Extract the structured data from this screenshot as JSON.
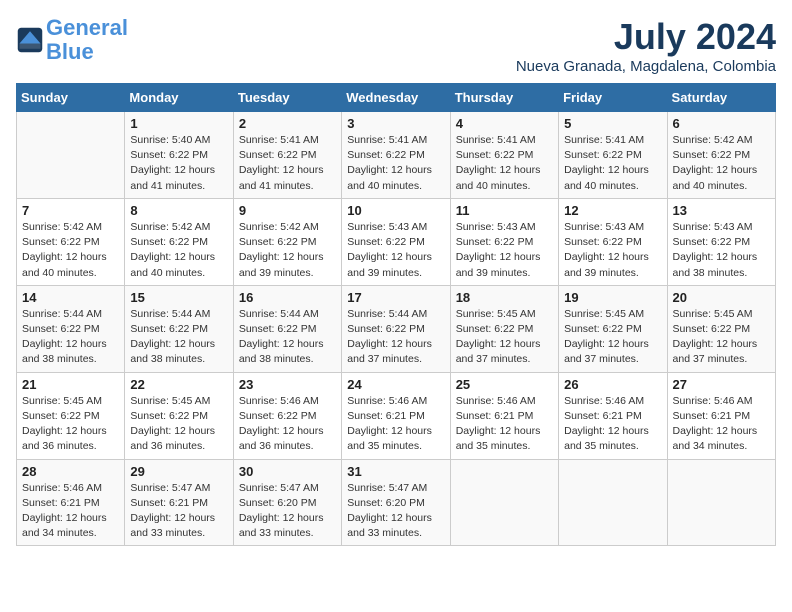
{
  "header": {
    "logo_line1": "General",
    "logo_line2": "Blue",
    "month": "July 2024",
    "location": "Nueva Granada, Magdalena, Colombia"
  },
  "weekdays": [
    "Sunday",
    "Monday",
    "Tuesday",
    "Wednesday",
    "Thursday",
    "Friday",
    "Saturday"
  ],
  "weeks": [
    [
      {
        "day": "",
        "info": ""
      },
      {
        "day": "1",
        "info": "Sunrise: 5:40 AM\nSunset: 6:22 PM\nDaylight: 12 hours\nand 41 minutes."
      },
      {
        "day": "2",
        "info": "Sunrise: 5:41 AM\nSunset: 6:22 PM\nDaylight: 12 hours\nand 41 minutes."
      },
      {
        "day": "3",
        "info": "Sunrise: 5:41 AM\nSunset: 6:22 PM\nDaylight: 12 hours\nand 40 minutes."
      },
      {
        "day": "4",
        "info": "Sunrise: 5:41 AM\nSunset: 6:22 PM\nDaylight: 12 hours\nand 40 minutes."
      },
      {
        "day": "5",
        "info": "Sunrise: 5:41 AM\nSunset: 6:22 PM\nDaylight: 12 hours\nand 40 minutes."
      },
      {
        "day": "6",
        "info": "Sunrise: 5:42 AM\nSunset: 6:22 PM\nDaylight: 12 hours\nand 40 minutes."
      }
    ],
    [
      {
        "day": "7",
        "info": "Sunrise: 5:42 AM\nSunset: 6:22 PM\nDaylight: 12 hours\nand 40 minutes."
      },
      {
        "day": "8",
        "info": "Sunrise: 5:42 AM\nSunset: 6:22 PM\nDaylight: 12 hours\nand 40 minutes."
      },
      {
        "day": "9",
        "info": "Sunrise: 5:42 AM\nSunset: 6:22 PM\nDaylight: 12 hours\nand 39 minutes."
      },
      {
        "day": "10",
        "info": "Sunrise: 5:43 AM\nSunset: 6:22 PM\nDaylight: 12 hours\nand 39 minutes."
      },
      {
        "day": "11",
        "info": "Sunrise: 5:43 AM\nSunset: 6:22 PM\nDaylight: 12 hours\nand 39 minutes."
      },
      {
        "day": "12",
        "info": "Sunrise: 5:43 AM\nSunset: 6:22 PM\nDaylight: 12 hours\nand 39 minutes."
      },
      {
        "day": "13",
        "info": "Sunrise: 5:43 AM\nSunset: 6:22 PM\nDaylight: 12 hours\nand 38 minutes."
      }
    ],
    [
      {
        "day": "14",
        "info": "Sunrise: 5:44 AM\nSunset: 6:22 PM\nDaylight: 12 hours\nand 38 minutes."
      },
      {
        "day": "15",
        "info": "Sunrise: 5:44 AM\nSunset: 6:22 PM\nDaylight: 12 hours\nand 38 minutes."
      },
      {
        "day": "16",
        "info": "Sunrise: 5:44 AM\nSunset: 6:22 PM\nDaylight: 12 hours\nand 38 minutes."
      },
      {
        "day": "17",
        "info": "Sunrise: 5:44 AM\nSunset: 6:22 PM\nDaylight: 12 hours\nand 37 minutes."
      },
      {
        "day": "18",
        "info": "Sunrise: 5:45 AM\nSunset: 6:22 PM\nDaylight: 12 hours\nand 37 minutes."
      },
      {
        "day": "19",
        "info": "Sunrise: 5:45 AM\nSunset: 6:22 PM\nDaylight: 12 hours\nand 37 minutes."
      },
      {
        "day": "20",
        "info": "Sunrise: 5:45 AM\nSunset: 6:22 PM\nDaylight: 12 hours\nand 37 minutes."
      }
    ],
    [
      {
        "day": "21",
        "info": "Sunrise: 5:45 AM\nSunset: 6:22 PM\nDaylight: 12 hours\nand 36 minutes."
      },
      {
        "day": "22",
        "info": "Sunrise: 5:45 AM\nSunset: 6:22 PM\nDaylight: 12 hours\nand 36 minutes."
      },
      {
        "day": "23",
        "info": "Sunrise: 5:46 AM\nSunset: 6:22 PM\nDaylight: 12 hours\nand 36 minutes."
      },
      {
        "day": "24",
        "info": "Sunrise: 5:46 AM\nSunset: 6:21 PM\nDaylight: 12 hours\nand 35 minutes."
      },
      {
        "day": "25",
        "info": "Sunrise: 5:46 AM\nSunset: 6:21 PM\nDaylight: 12 hours\nand 35 minutes."
      },
      {
        "day": "26",
        "info": "Sunrise: 5:46 AM\nSunset: 6:21 PM\nDaylight: 12 hours\nand 35 minutes."
      },
      {
        "day": "27",
        "info": "Sunrise: 5:46 AM\nSunset: 6:21 PM\nDaylight: 12 hours\nand 34 minutes."
      }
    ],
    [
      {
        "day": "28",
        "info": "Sunrise: 5:46 AM\nSunset: 6:21 PM\nDaylight: 12 hours\nand 34 minutes."
      },
      {
        "day": "29",
        "info": "Sunrise: 5:47 AM\nSunset: 6:21 PM\nDaylight: 12 hours\nand 33 minutes."
      },
      {
        "day": "30",
        "info": "Sunrise: 5:47 AM\nSunset: 6:20 PM\nDaylight: 12 hours\nand 33 minutes."
      },
      {
        "day": "31",
        "info": "Sunrise: 5:47 AM\nSunset: 6:20 PM\nDaylight: 12 hours\nand 33 minutes."
      },
      {
        "day": "",
        "info": ""
      },
      {
        "day": "",
        "info": ""
      },
      {
        "day": "",
        "info": ""
      }
    ]
  ]
}
